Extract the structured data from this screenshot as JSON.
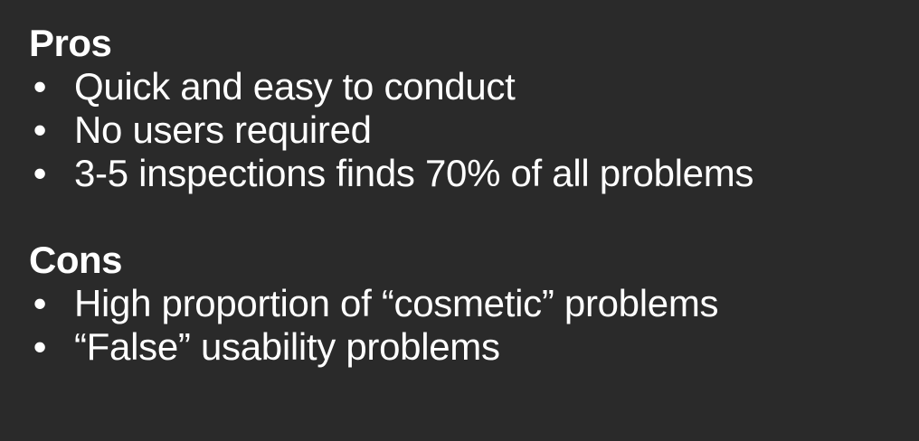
{
  "pros": {
    "heading": "Pros",
    "items": [
      "Quick and easy to conduct",
      "No users required",
      "3-5 inspections finds 70% of all problems"
    ]
  },
  "cons": {
    "heading": "Cons",
    "items": [
      "High proportion of “cosmetic” problems",
      "“False” usability problems"
    ]
  },
  "bullet_glyph": "•",
  "colors": {
    "background": "#2a2a2a",
    "text": "#ffffff"
  }
}
